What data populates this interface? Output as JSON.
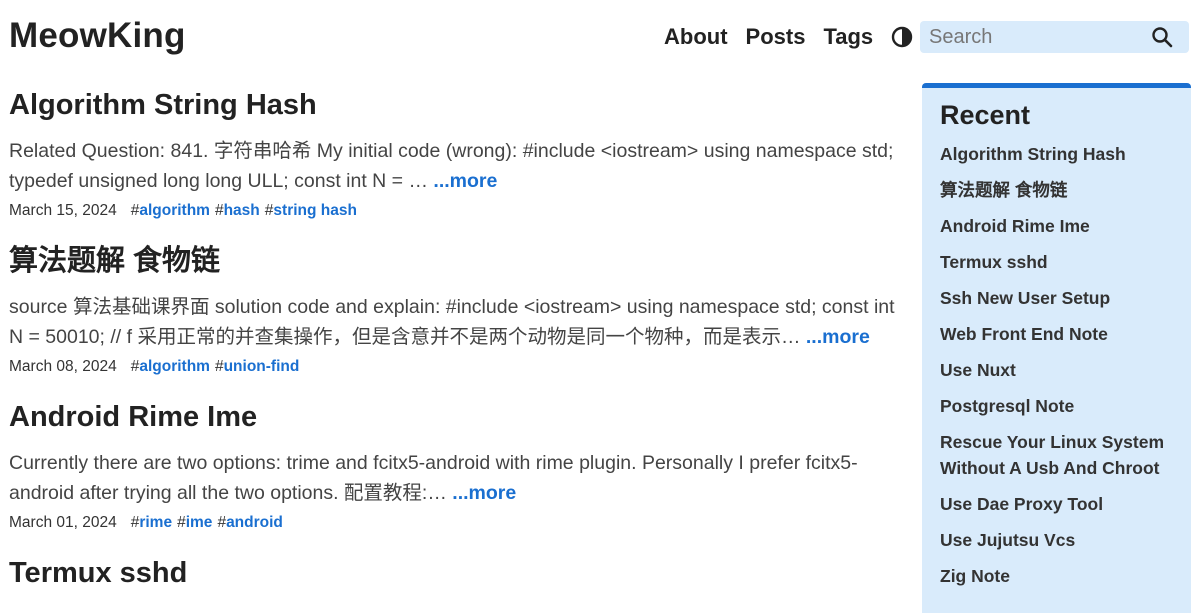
{
  "header": {
    "site_title": "MeowKing",
    "nav": [
      "About",
      "Posts",
      "Tags"
    ],
    "search_placeholder": "Search"
  },
  "posts": [
    {
      "title": "Algorithm String Hash",
      "summary": "Related Question: 841. 字符串哈希 My initial code (wrong): #include <iostream> using namespace std; typedef unsigned long long ULL; const int N = …",
      "more": "...more",
      "date": "March 15, 2024",
      "tags": [
        "algorithm",
        "hash",
        "string hash"
      ]
    },
    {
      "title": "算法题解 食物链",
      "summary": "source 算法基础课界面 solution code and explain: #include <iostream> using namespace std; const int N = 50010; // f 采用正常的并查集操作，但是含意并不是两个动物是同一个物种，而是表示…",
      "more": "...more",
      "date": "March 08, 2024",
      "tags": [
        "algorithm",
        "union-find"
      ]
    },
    {
      "title": "Android Rime Ime",
      "summary": "Currently there are two options: trime and fcitx5-android with rime plugin. Personally I prefer fcitx5-android after trying all the two options. 配置教程:…",
      "more": "...more",
      "date": "March 01, 2024",
      "tags": [
        "rime",
        "ime",
        "android"
      ]
    },
    {
      "title": "Termux sshd",
      "summary": "",
      "more": "",
      "date": "",
      "tags": []
    }
  ],
  "sidebar": {
    "heading": "Recent",
    "items": [
      "Algorithm String Hash",
      "算法题解 食物链",
      "Android Rime Ime",
      "Termux sshd",
      "Ssh New User Setup",
      "Web Front End Note",
      "Use Nuxt",
      "Postgresql Note",
      "Rescue Your Linux System Without A Usb And Chroot",
      "Use Dae Proxy Tool",
      "Use Jujutsu Vcs",
      "Zig Note"
    ]
  },
  "colors": {
    "accent": "#1a6fd0",
    "sidebar_bg": "#d9ebfb",
    "text": "#222222"
  },
  "icons": {
    "theme": "half-circle-contrast-icon",
    "search": "magnifier-icon"
  }
}
